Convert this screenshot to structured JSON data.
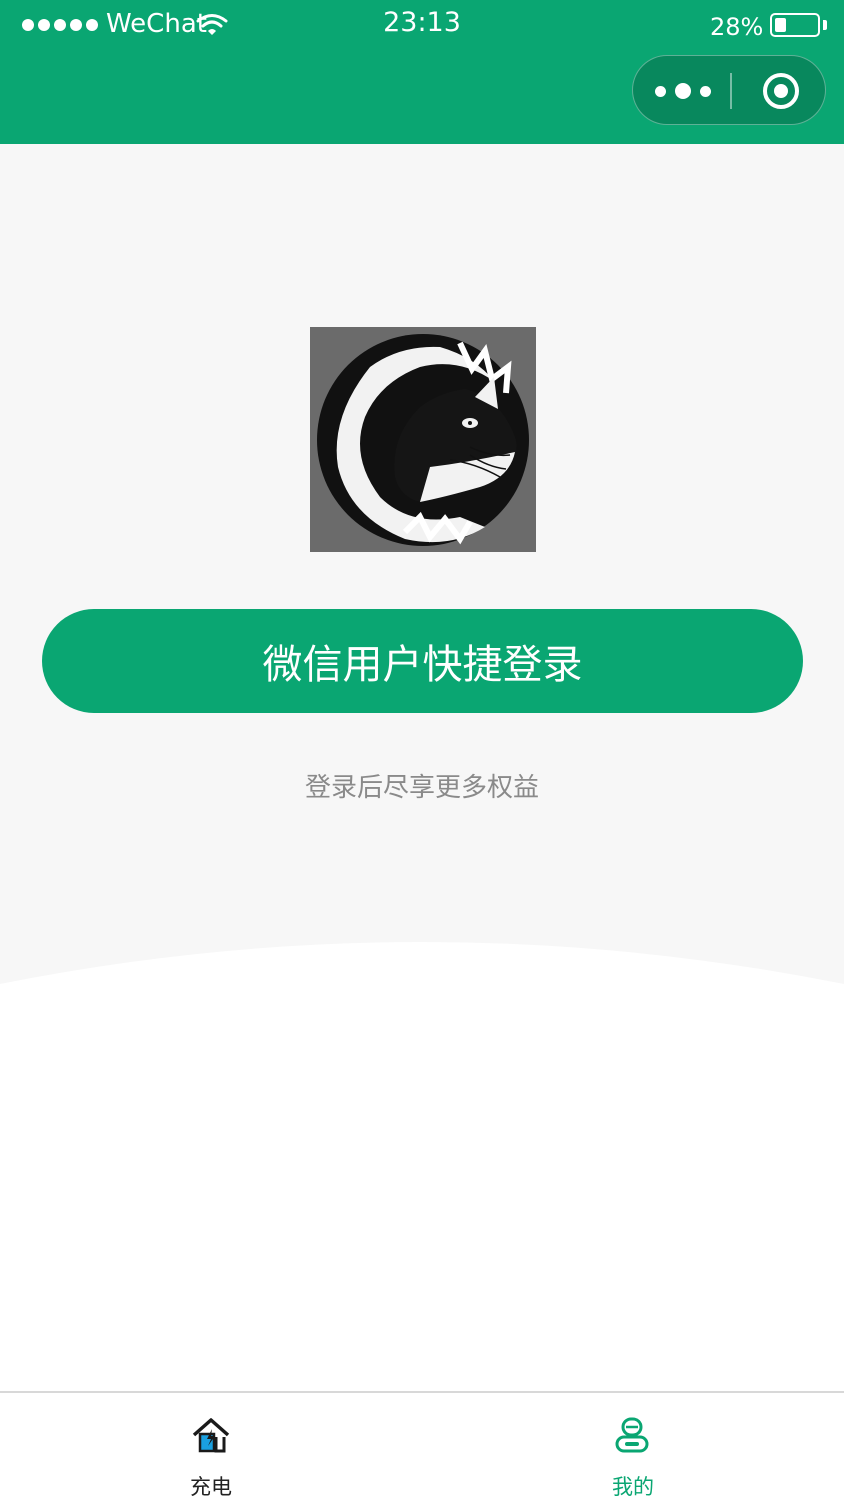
{
  "status_bar": {
    "carrier": "WeChat",
    "time": "23:13",
    "battery_percent": "28%",
    "battery_level": 0.28
  },
  "capsule": {
    "more_icon": "more-dots-icon",
    "close_icon": "target-circle-icon"
  },
  "app": {
    "logo_icon": "panther-logo",
    "login_button": "微信用户快捷登录",
    "login_hint": "登录后尽享更多权益"
  },
  "tabbar": {
    "items": [
      {
        "label": "充电",
        "icon": "home-charge-icon",
        "active": false
      },
      {
        "label": "我的",
        "icon": "user-profile-icon",
        "active": true
      }
    ]
  },
  "colors": {
    "brand": "#0aa672",
    "background": "#f7f7f7",
    "hint_text": "#8a8a8a"
  }
}
